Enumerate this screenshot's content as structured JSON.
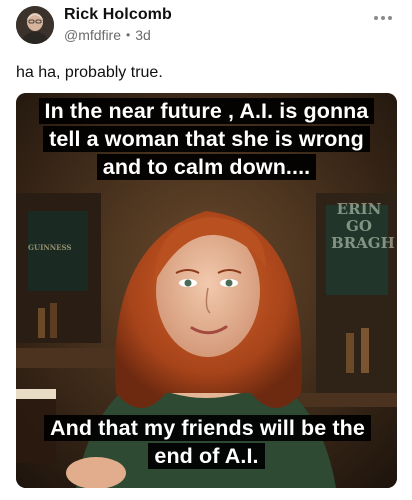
{
  "author": {
    "name": "Rick Holcomb",
    "handle": "@mfdfire",
    "separator": "•",
    "time": "3d"
  },
  "post": {
    "text": "ha ha, probably true."
  },
  "meme": {
    "top_caption": "In the near future , A.I. is gonna tell a woman that she is wrong and to calm down....",
    "bottom_caption": "And that my friends will be the end of A.I.",
    "sign_erin": "ERIN GO BRAGH",
    "sign_guinness": "GUINNESS"
  },
  "icons": {
    "more": "more-horizontal-icon",
    "avatar": "user-avatar"
  }
}
